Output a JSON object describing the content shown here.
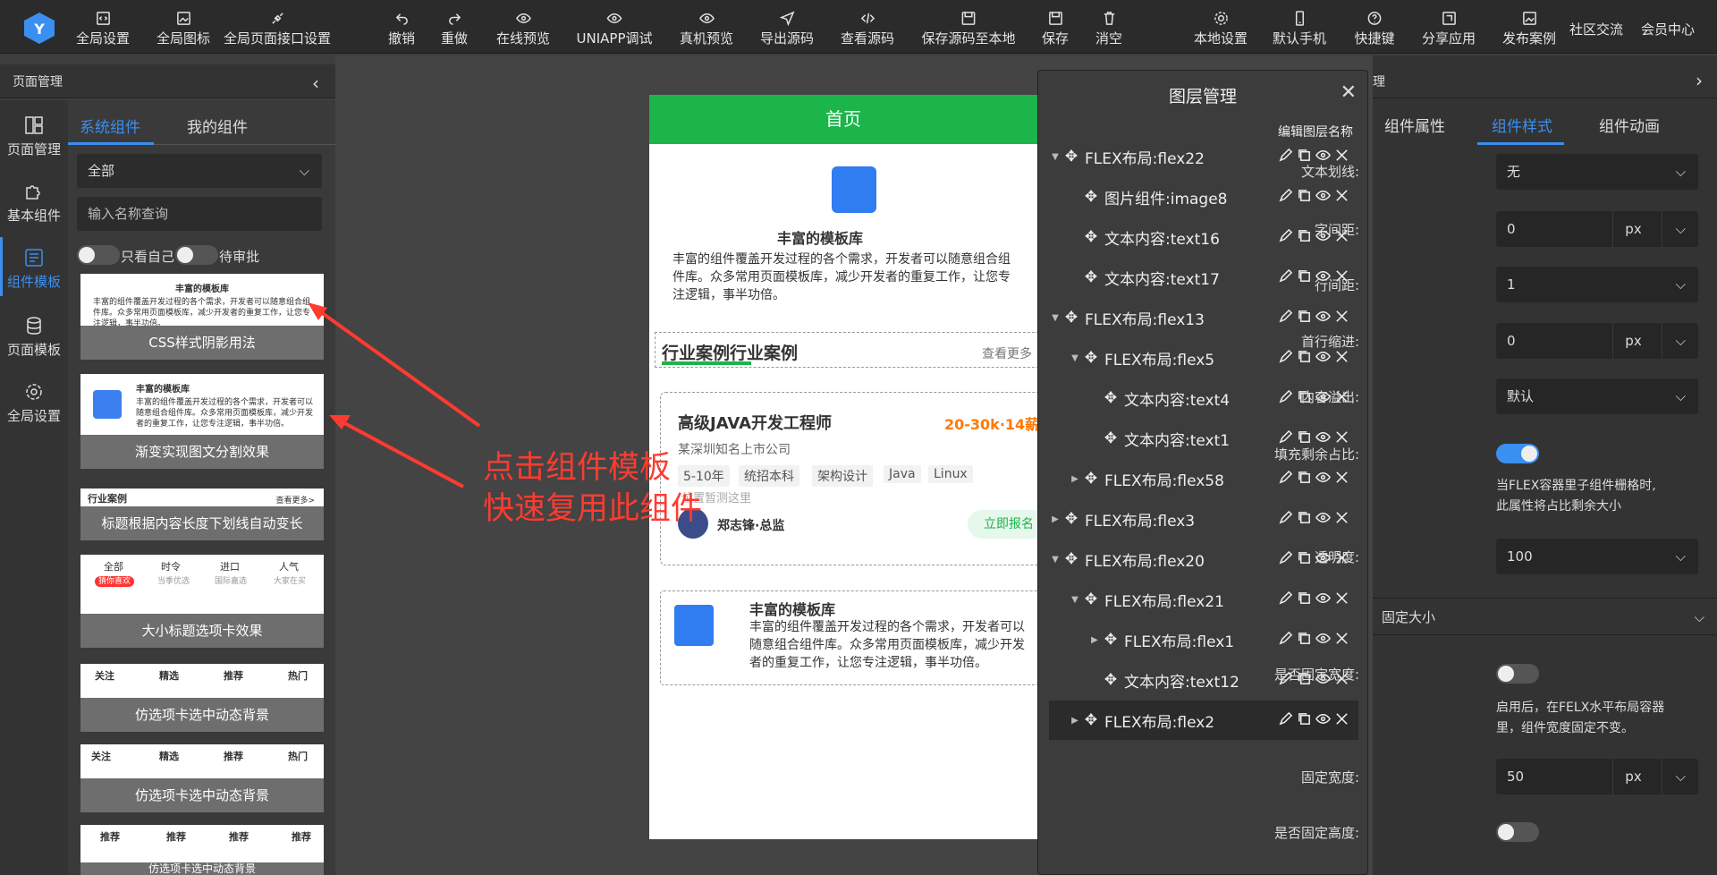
{
  "toolbar": {
    "left": [
      "全局设置",
      "全局图标",
      "全局页面接口设置"
    ],
    "mid": [
      "撤销",
      "重做",
      "在线预览",
      "UNIAPP调试",
      "真机预览",
      "导出源码",
      "查看源码",
      "保存源码至本地",
      "保存",
      "消空"
    ],
    "right": [
      "本地设置",
      "默认手机",
      "快捷键",
      "分享应用",
      "发布案例"
    ],
    "right_text": [
      "社区交流",
      "会员中心"
    ]
  },
  "left_panel": {
    "header": "页面管理",
    "nav": [
      "页面管理",
      "基本组件",
      "组件模板",
      "页面模板",
      "全局设置"
    ],
    "tabs": [
      "系统组件",
      "我的组件"
    ],
    "category": "全部",
    "search_placeholder": "输入名称查询",
    "toggle1": "只看自己",
    "toggle2": "待审批",
    "cards": [
      "CSS样式阴影用法",
      "渐变实现图文分割效果",
      "标题根据内容长度下划线自动变长",
      "大小标题选项卡效果",
      "仿选项卡选中动态背景",
      "仿选项卡选中动态背景",
      "仿选项卡选中动态背景"
    ],
    "card1": {
      "title": "丰富的模板库",
      "text": "丰富的组件覆盖开发过程的各个需求，开发者可以随意组合组件库。众多常用页面模板库，减少开发者的重复工作，让您专注逻辑，事半功倍。"
    },
    "card2": {
      "title": "丰富的模板库",
      "text": "丰富的组件覆盖开发过程的各个需求，开发者可以随意组合组件库。众多常用页面模板库，减少开发者的重复工作，让您专注逻辑，事半功倍。"
    },
    "card3": {
      "title": "行业案例",
      "more": "查看更多>"
    },
    "card4": {
      "tabs": [
        "全部",
        "时令",
        "进口",
        "人气"
      ],
      "subs": [
        "猜你喜欢",
        "当季优选",
        "国际嘉选",
        "大家在买"
      ]
    },
    "card5": {
      "tabs": [
        "关注",
        "精选",
        "推荐",
        "热门"
      ]
    },
    "card6": {
      "tabs": [
        "关注",
        "精选",
        "推荐",
        "热门"
      ]
    },
    "card7": {
      "tabs": [
        "推荐",
        "推荐",
        "推荐",
        "推荐"
      ]
    }
  },
  "annotation": [
    "点击组件模板",
    "快速复用此组件"
  ],
  "phone": {
    "title": "首页",
    "hero_title": "丰富的模板库",
    "hero_text": [
      "丰富的组件覆盖开发过程的各个需求，开发者可以随意组合组",
      "件库。众多常用页面模板库，减少开发者的重复工作，让您专",
      "注逻辑，事半功倍。"
    ],
    "section_title": "行业案例行业案例",
    "section_more": "查看更多",
    "job_title": "高级JAVA开发工程师",
    "job_salary": "20-30k·14薪",
    "company": "某深圳知名上市公司",
    "tags": [
      "5-10年",
      "统招本科",
      "架构设计",
      "Java",
      "Linux"
    ],
    "hint": "位置暂测这里",
    "recruiter": "郑志锋·总监",
    "apply": "立即报名",
    "card2_title": "丰富的模板库",
    "card2_text": [
      "丰富的组件覆盖开发过程的各个需求，开发者可以",
      "随意组合组件库。众多常用页面模板库，减少开发",
      "者的重复工作，让您专注逻辑，事半功倍。"
    ]
  },
  "layer_panel": {
    "title": "图层管理",
    "edit": "编辑图层名称",
    "rows": [
      {
        "label": "FLEX布局:flex22",
        "arrow": "▼"
      },
      {
        "label": "图片组件:image8",
        "arrow": ""
      },
      {
        "label": "文本内容:text16",
        "arrow": ""
      },
      {
        "label": "文本内容:text17",
        "arrow": ""
      },
      {
        "label": "FLEX布局:flex13",
        "arrow": "▼"
      },
      {
        "label": "FLEX布局:flex5",
        "arrow": "▼"
      },
      {
        "label": "文本内容:text4",
        "arrow": ""
      },
      {
        "label": "文本内容:text1",
        "arrow": ""
      },
      {
        "label": "FLEX布局:flex58",
        "arrow": "▶"
      },
      {
        "label": "FLEX布局:flex3",
        "arrow": "▶"
      },
      {
        "label": "FLEX布局:flex20",
        "arrow": "▼"
      },
      {
        "label": "FLEX布局:flex21",
        "arrow": "▼"
      },
      {
        "label": "FLEX布局:flex1",
        "arrow": "▶"
      },
      {
        "label": "文本内容:text12",
        "arrow": ""
      },
      {
        "label": "FLEX布局:flex2",
        "arrow": "▶"
      }
    ]
  },
  "right_panel": {
    "header": "理",
    "tabs": [
      "组件属性",
      "组件样式",
      "组件动画"
    ],
    "fields": {
      "text_decoration": {
        "label": "文本划线:",
        "value": "无"
      },
      "letter_spacing": {
        "label": "字间距:",
        "value": "0",
        "unit": "px"
      },
      "line_height": {
        "label": "行间距:",
        "value": "1"
      },
      "text_indent": {
        "label": "首行缩进:",
        "value": "0",
        "unit": "px"
      },
      "overflow": {
        "label": "内容溢出:",
        "value": "默认"
      },
      "flex_fill": {
        "label": "填充剩余占比:",
        "note": [
          "当FLEX容器里子组件栅格时,",
          "此属性将占比剩余大小"
        ]
      },
      "opacity": {
        "label": "透明度:",
        "value": "100"
      }
    },
    "section": "固定大小",
    "fixed_width_toggle": {
      "label": "是否固定宽度:",
      "note": [
        "启用后，在FELX水平布局容器",
        "里，组件宽度固定不变。"
      ]
    },
    "fixed_width": {
      "label": "固定宽度:",
      "value": "50",
      "unit": "px"
    },
    "fixed_height_toggle": {
      "label": "是否固定高度:"
    }
  },
  "colors": {
    "accent": "#3b8ff0",
    "green": "#1bb54a",
    "annotation": "#ff3b30",
    "salary": "#ff7a00"
  }
}
